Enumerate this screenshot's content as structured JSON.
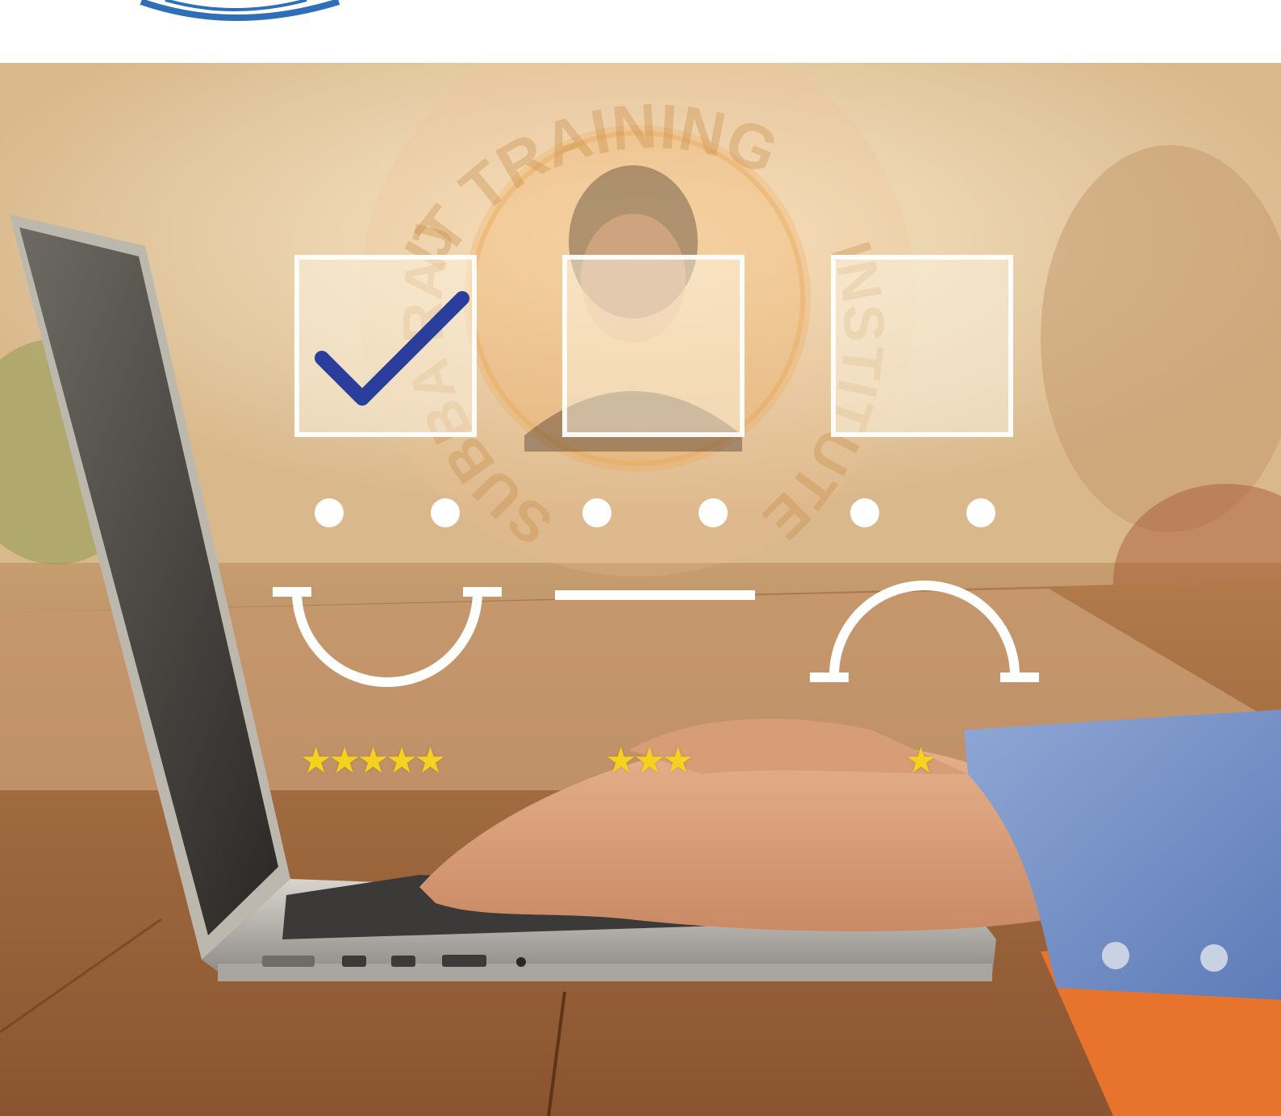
{
  "watermark": {
    "top_arc_text": "IT TRAINING",
    "right_arc_text": "INSTITUTES",
    "left_arc_text": "SUBBA RAJU'S"
  },
  "rating_widget": {
    "boxes": [
      {
        "state": "checked",
        "icon": "checkmark-icon"
      },
      {
        "state": "unchecked"
      },
      {
        "state": "unchecked"
      }
    ],
    "faces": [
      "smile-icon",
      "neutral-icon",
      "frown-icon"
    ],
    "star_ratings": [
      5,
      3,
      1
    ],
    "star_color": "#f6d21f"
  },
  "colors": {
    "watermark_orange": "#e8a24a",
    "checkmark_blue": "#2a3f9b",
    "logo_blue": "#2f6fb7"
  }
}
